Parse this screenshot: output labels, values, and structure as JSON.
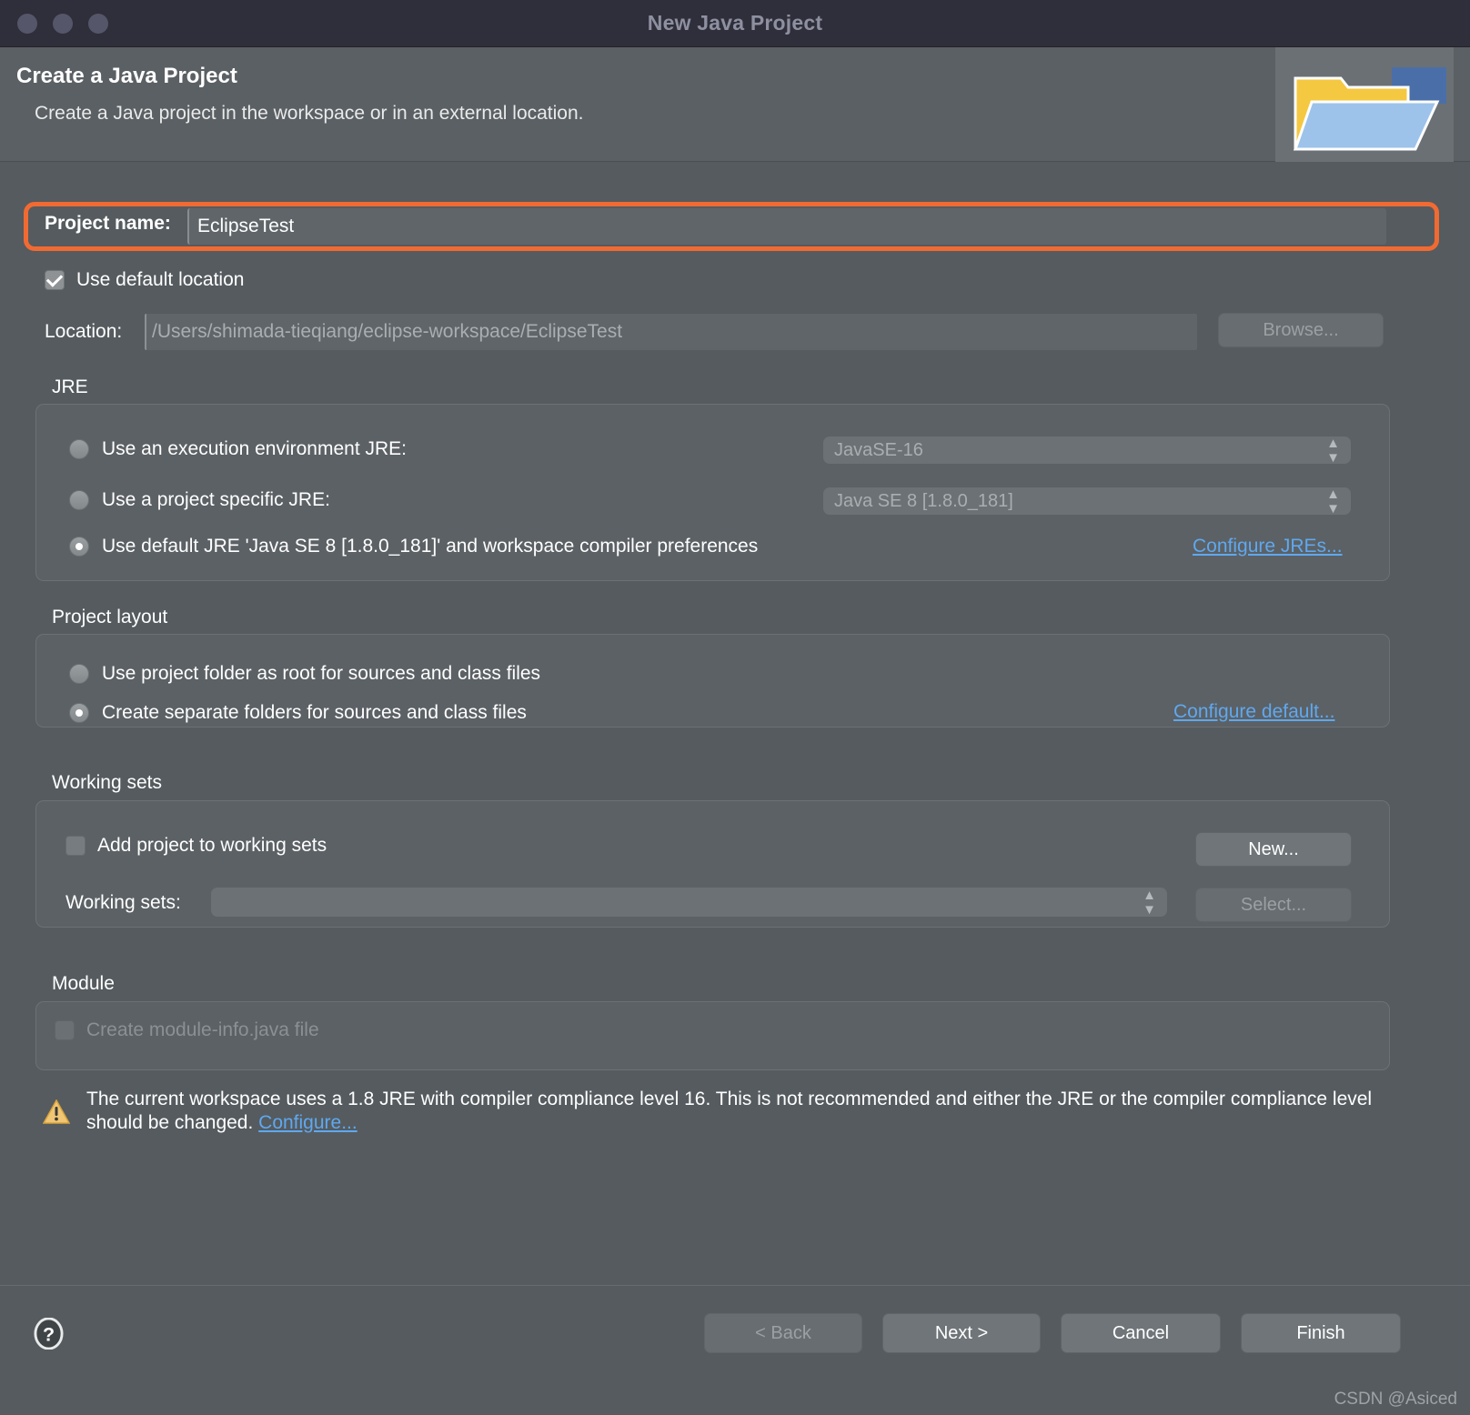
{
  "window": {
    "title": "New Java Project",
    "traffic_lights": [
      "close",
      "minimize",
      "zoom"
    ]
  },
  "header": {
    "title": "Create a Java Project",
    "subtitle": "Create a Java project in the workspace or in an external location.",
    "icon": "open-folder-icon"
  },
  "project_name": {
    "label": "Project name:",
    "value": "EclipseTest",
    "placeholder": "",
    "highlight_color": "#f16a32"
  },
  "use_default_location": {
    "label": "Use default location",
    "checked": true
  },
  "location": {
    "label": "Location:",
    "value": "/Users/shimada-tieqiang/eclipse-workspace/EclipseTest",
    "disabled": true,
    "browse_label": "Browse...",
    "browse_disabled": true
  },
  "jre": {
    "group_title": "JRE",
    "options": [
      {
        "label": "Use an execution environment JRE:",
        "selected": false,
        "combo_value": "JavaSE-16",
        "combo_disabled": true
      },
      {
        "label": "Use a project specific JRE:",
        "selected": false,
        "combo_value": "Java SE 8 [1.8.0_181]",
        "combo_disabled": true
      },
      {
        "label": "Use default JRE 'Java SE 8 [1.8.0_181]' and workspace compiler preferences",
        "selected": true
      }
    ],
    "configure_link": "Configure JREs..."
  },
  "project_layout": {
    "group_title": "Project layout",
    "options": [
      {
        "label": "Use project folder as root for sources and class files",
        "selected": false
      },
      {
        "label": "Create separate folders for sources and class files",
        "selected": true
      }
    ],
    "configure_link": "Configure default..."
  },
  "working_sets": {
    "group_title": "Working sets",
    "add_checkbox": {
      "label": "Add project to working sets",
      "checked": false
    },
    "new_button": "New...",
    "combo_label": "Working sets:",
    "combo_value": "",
    "combo_disabled": true,
    "select_button": "Select...",
    "select_disabled": true
  },
  "module": {
    "group_title": "Module",
    "checkbox": {
      "label": "Create module-info.java file",
      "checked": false,
      "disabled": true
    }
  },
  "warning": {
    "icon": "warning-triangle-icon",
    "text_before_link": "The current workspace uses a 1.8 JRE with compiler compliance level 16. This is not recommended and either the JRE or the compiler compliance level should be changed. ",
    "link": "Configure..."
  },
  "footer": {
    "help_icon": "help-question-icon",
    "buttons": [
      {
        "label": "< Back",
        "disabled": true
      },
      {
        "label": "Next >",
        "disabled": false
      },
      {
        "label": "Cancel",
        "disabled": false
      },
      {
        "label": "Finish",
        "disabled": false
      }
    ]
  },
  "watermark": "CSDN @Asiced"
}
